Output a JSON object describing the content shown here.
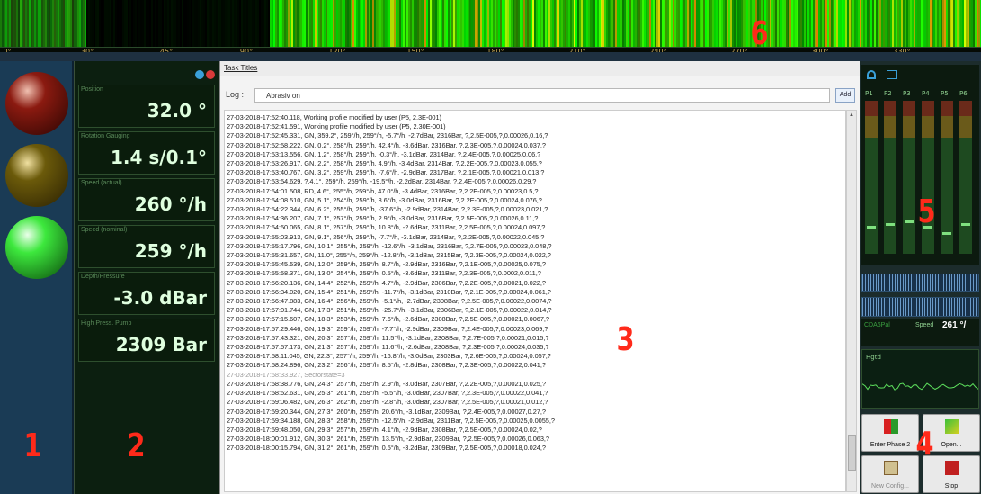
{
  "topbar": {
    "scale_ticks": [
      "0°",
      "30°",
      "45°",
      "90°",
      "120°",
      "150°",
      "180°",
      "210°",
      "240°",
      "270°",
      "300°",
      "330°"
    ]
  },
  "callouts": {
    "n1": "1",
    "n2": "2",
    "n3": "3",
    "n4": "4",
    "n5": "5",
    "n6": "6"
  },
  "leds": {
    "red": "#8b1a10",
    "amber": "#6b5a0a",
    "green": "#3de83d"
  },
  "values": [
    {
      "label": "Position",
      "value": "32.0 °"
    },
    {
      "label": "Rotation Gauging",
      "value": "1.4 s/0.1°"
    },
    {
      "label": "Speed (actual)",
      "value": "260 °/h"
    },
    {
      "label": "Speed (nominal)",
      "value": "259 °/h"
    },
    {
      "label": "Depth/Pressure",
      "value": "-3.0 dBar"
    },
    {
      "label": "High Press. Pump",
      "value": "2309 Bar"
    }
  ],
  "main": {
    "tab": "Task Titles",
    "log_label": "Log :",
    "log_value": "Abrasiv on",
    "add_label": "Add",
    "lines": [
      "27-03-2018-17:52:40.118, Working profile modified by user (P5, 2.3E-001)",
      "27-03-2018-17:52:41.591, Working profile modified by user (P5, 2.30E-001)",
      "27-03-2018-17:52:45.331, GN, 359.2°, 259°/h, 259°/h, -5.7°/h, -2.7dBar, 2316Bar, ?,2.5E-005,?,0.00026,0.16,?",
      "27-03-2018-17:52:58.222, GN, 0.2°, 258°/h, 259°/h, 42.4°/h, -3.6dBar, 2316Bar, ?,2.3E-005,?,0.00024,0.037,?",
      "27-03-2018-17:53:13.556, GN, 1.2°, 258°/h, 259°/h, -0.3°/h, -3.1dBar, 2314Bar, ?,2.4E-005,?,0.00025,0.06,?",
      "27-03-2018-17:53:26.917, GN, 2.2°, 258°/h, 259°/h, 4.9°/h, -3.4dBar, 2314Bar, ?,2.2E-005,?,0.00023,0.055,?",
      "27-03-2018-17:53:40.767, GN, 3.2°, 259°/h, 259°/h, -7.6°/h, -2.9dBar, 2317Bar, ?,2.1E-005,?,0.00021,0.013,?",
      "27-03-2018-17:53:54.629, ?,4.1°, 259°/h, 259°/h, -19.5°/h, -2.2dBar, 2314Bar, ?,2.4E-005,?,0.00026,0.29,?",
      "27-03-2018-17:54:01.508, RD, 4.6°, 255°/h, 259°/h, 47.0°/h, -3.4dBar, 2316Bar, ?,2.2E-005,?,0.00023,0.5,?",
      "27-03-2018-17:54:08.510, GN, 5.1°, 254°/h, 259°/h, 8.6°/h, -3.0dBar, 2316Bar, ?,2.2E-005,?,0.00024,0.076,?",
      "27-03-2018-17:54:22.344, GN, 6.2°, 255°/h, 259°/h, -37.6°/h, -2.9dBar, 2314Bar, ?,2.3E-005,?,0.00023,0.021,?",
      "27-03-2018-17:54:36.207, GN, 7.1°, 257°/h, 259°/h, 2.9°/h, -3.0dBar, 2316Bar, ?,2.5E-005,?,0.00026,0.11,?",
      "27-03-2018-17:54:50.065, GN, 8.1°, 257°/h, 259°/h, 10.8°/h, -2.6dBar, 2311Bar, ?,2.5E-005,?,0.00024,0.097,?",
      "27-03-2018-17:55:03.913, GN, 9.1°, 256°/h, 259°/h, -7.7°/h, -3.1dBar, 2314Bar, ?,2.2E-005,?,0.00022,0.045,?",
      "27-03-2018-17:55:17.796, GN, 10.1°, 255°/h, 259°/h, -12.6°/h, -3.1dBar, 2316Bar, ?,2.7E-005,?,0.00023,0.048,?",
      "27-03-2018-17:55:31.657, GN, 11.0°, 255°/h, 259°/h, -12.8°/h, -3.1dBar, 2315Bar, ?,2.3E-005,?,0.00024,0.022,?",
      "27-03-2018-17:55:45.539, GN, 12.0°, 259°/h, 259°/h, 8.7°/h, -2.9dBar, 2316Bar, ?,2.1E-005,?,0.00025,0.075,?",
      "27-03-2018-17:55:58.371, GN, 13.0°, 254°/h, 259°/h, 0.5°/h, -3.6dBar, 2311Bar, ?,2.3E-005,?,0.0002,0.011,?",
      "27-03-2018-17:56:20.136, GN, 14.4°, 252°/h, 259°/h, 4.7°/h, -2.9dBar, 2306Bar, ?,2.2E-005,?,0.00021,0.022,?",
      "27-03-2018-17:56:34.020, GN, 15.4°, 251°/h, 259°/h, -11.7°/h, -3.1dBar, 2310Bar, ?,2.1E-005,?,0.00024,0.061,?",
      "27-03-2018-17:56:47.883, GN, 16.4°, 256°/h, 259°/h, -5.1°/h, -2.7dBar, 2308Bar, ?,2.5E-005,?,0.00022,0.0074,?",
      "27-03-2018-17:57:01.744, GN, 17.3°, 251°/h, 259°/h, -25.7°/h, -3.1dBar, 2306Bar, ?,2.1E-005,?,0.00022,0.014,?",
      "27-03-2018-17:57:15.607, GN, 18.3°, 253°/h, 259°/h, 7.6°/h, -2.6dBar, 2308Bar, ?,2.5E-005,?,0.00021,0.0067,?",
      "27-03-2018-17:57:29.446, GN, 19.3°, 259°/h, 259°/h, -7.7°/h, -2.9dBar, 2309Bar, ?,2.4E-005,?,0.00023,0.069,?",
      "27-03-2018-17:57:43.321, GN, 20.3°, 257°/h, 259°/h, 11.5°/h, -3.1dBar, 2308Bar, ?,2.7E-005,?,0.00021,0.015,?",
      "27-03-2018-17:57:57.173, GN, 21.3°, 257°/h, 259°/h, 11.6°/h, -2.6dBar, 2308Bar, ?,2.3E-005,?,0.00024,0.035,?",
      "27-03-2018-17:58:11.045, GN, 22.3°, 257°/h, 259°/h, -16.8°/h, -3.0dBar, 2303Bar, ?,2.6E-005,?,0.00024,0.057,?",
      "27-03-2018-17:58:24.896, GN, 23.2°, 256°/h, 259°/h, 8.5°/h, -2.8dBar, 2308Bar, ?,2.3E-005,?,0.00022,0.041,?",
      "27-03-2018-17:58:33.927, Sectorstate=3",
      "27-03-2018-17:58:38.776, GN, 24.3°, 257°/h, 259°/h, 2.9°/h, -3.0dBar, 2307Bar, ?,2.2E-005,?,0.00021,0.025,?",
      "27-03-2018-17:58:52.631, GN, 25.3°, 261°/h, 259°/h, -5.5°/h, -3.0dBar, 2307Bar, ?,2.3E-005,?,0.00022,0.041,?",
      "27-03-2018-17:59:06.482, GN, 26.3°, 262°/h, 259°/h, -2.8°/h, -3.0dBar, 2307Bar, ?,2.5E-005,?,0.00021,0.012,?",
      "27-03-2018-17:59:20.344, GN, 27.3°, 260°/h, 259°/h, 20.6°/h, -3.1dBar, 2309Bar, ?,2.4E-005,?,0.00027,0.27,?",
      "27-03-2018-17:59:34.188, GN, 28.3°, 258°/h, 259°/h, -12.5°/h, -2.9dBar, 2311Bar, ?,2.5E-005,?,0.00025,0.0055,?",
      "27-03-2018-17:59:48.050, GN, 29.3°, 257°/h, 259°/h, 4.1°/h, -2.9dBar, 2308Bar, ?,2.5E-005,?,0.00024,0.02,?",
      "27-03-2018-18:00:01.912, GN, 30.3°, 261°/h, 259°/h, 13.5°/h, -2.9dBar, 2309Bar, ?,2.5E-005,?,0.00026,0.063,?",
      "27-03-2018-18:00:15.794, GN, 31.2°, 261°/h, 259°/h, 0.5°/h, -3.2dBar, 2309Bar, ?,2.5E-005,?,0.00018,0.024,?"
    ]
  },
  "right": {
    "fader_labels": [
      "P1",
      "P2",
      "P3",
      "P4",
      "P5",
      "P6"
    ],
    "status_left": "CDA6Pal",
    "status_speed": "Speed",
    "status_value": "261 °/",
    "osc_label": "Hgtd",
    "buttons": [
      {
        "label": "Enter Phase 2"
      },
      {
        "label": "Open..."
      },
      {
        "label": "New Config..."
      },
      {
        "label": "Stop"
      }
    ]
  }
}
